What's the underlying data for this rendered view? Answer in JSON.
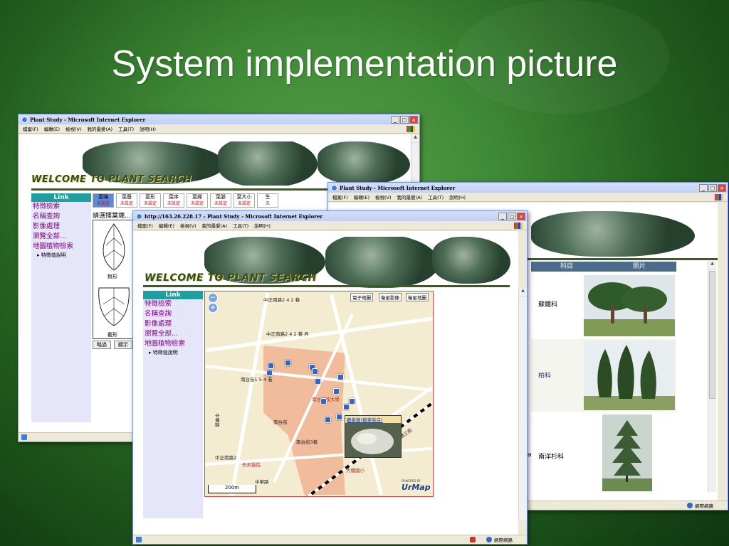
{
  "slide": {
    "title": "System implementation picture"
  },
  "ie": {
    "menu": [
      "檔案(F)",
      "編輯(E)",
      "檢視(V)",
      "我的最愛(A)",
      "工具(T)",
      "說明(H)"
    ],
    "status_zone": "網際網路"
  },
  "win1": {
    "title": "Plant Study - Microsoft Internet Explorer",
    "welcome": "WELCOME TO PLANT SEARCH",
    "link_head": "Link",
    "nav": [
      "特徵檢索",
      "名稱查詢",
      "影像處理",
      "瀏覽全部...",
      "地圖植物檢索"
    ],
    "sub": "特徵值說明",
    "tabs": [
      {
        "label": "葉端",
        "status": "未設定"
      },
      {
        "label": "葉基",
        "status": "未設定"
      },
      {
        "label": "葉形",
        "status": "未設定"
      },
      {
        "label": "葉序",
        "status": "未設定"
      },
      {
        "label": "葉緣",
        "status": "未設定"
      },
      {
        "label": "葉脈",
        "status": "未設定"
      },
      {
        "label": "葉大小",
        "status": "未設定"
      },
      {
        "label": "生",
        "status": "未"
      }
    ],
    "prompt": "請選擇葉端...",
    "leaf_labels": [
      "銳形",
      "截形"
    ],
    "buttons": [
      "略過",
      "顯示"
    ]
  },
  "win2": {
    "title": "Plant Study - Microsoft Internet Explorer",
    "columns": [
      "科目",
      "照片"
    ],
    "rows": [
      {
        "family": "蘇鐵科"
      },
      {
        "family": "柏科"
      },
      {
        "family": "南洋杉科"
      }
    ],
    "fragment_a": "a"
  },
  "win3": {
    "title": "http://163.26.228.17 - Plant Study - Microsoft Internet Explorer",
    "welcome": "WELCOME TO PLANT SEARCH",
    "link_head": "Link",
    "nav": [
      "特徵檢索",
      "名稱查詢",
      "影像處理",
      "瀏覽全部...",
      "地圖植物檢索"
    ],
    "sub": "特徵值說明",
    "map": {
      "buttons": [
        "電子地圖",
        "衛星影像",
        "衛星地圖"
      ],
      "labels": [
        "中正南路2 4 2 巷",
        "中正南路2 4 2 巷 弄",
        "南台街1 5 4 巷",
        "南台科技大學",
        "南台街",
        "中正南路2",
        "中華路",
        "奇美醫院",
        "大橋國小",
        "大橋三街",
        "南台街3巷",
        "中華路"
      ],
      "popup": "鵝掌藤(鵝掌柴白)",
      "scale": "200m",
      "brand": "UrMap",
      "powered": "POWERED BY"
    }
  }
}
